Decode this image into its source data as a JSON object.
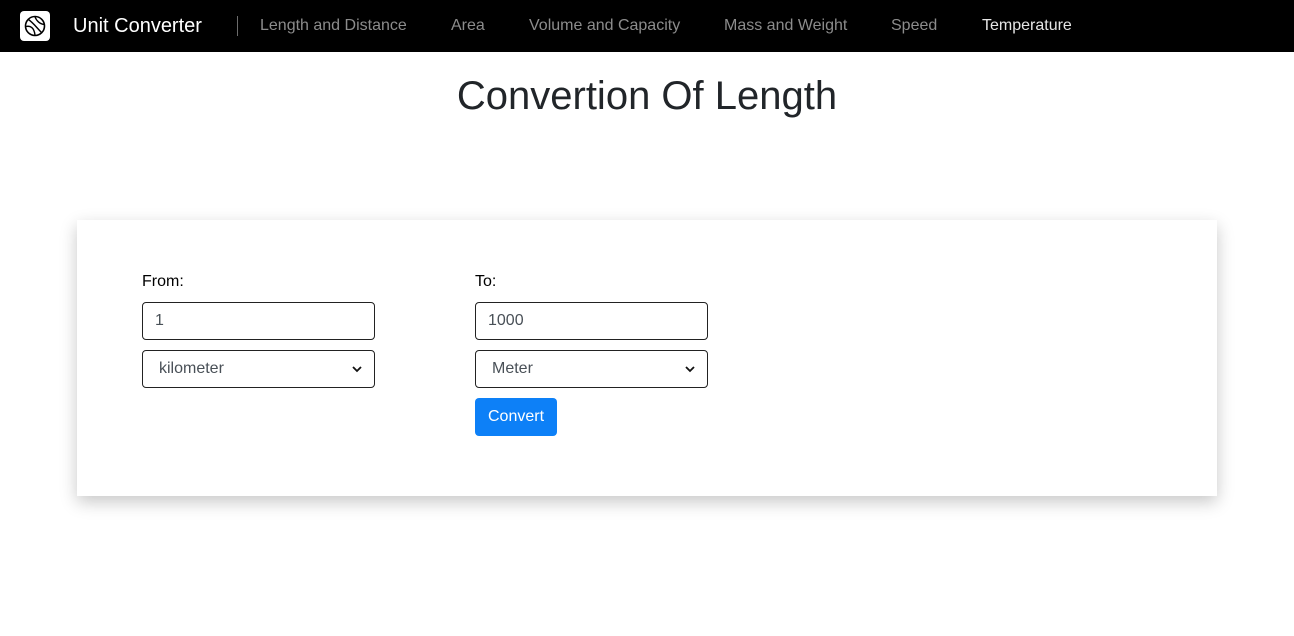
{
  "navbar": {
    "brand": "Unit Converter",
    "links": [
      {
        "label": "Length and Distance"
      },
      {
        "label": "Area"
      },
      {
        "label": "Volume and Capacity"
      },
      {
        "label": "Mass and Weight"
      },
      {
        "label": "Speed"
      },
      {
        "label": "Temperature"
      }
    ]
  },
  "page": {
    "title": "Convertion Of Length"
  },
  "form": {
    "from_label": "From:",
    "from_value": "1",
    "from_unit": "kilometer",
    "to_label": "To:",
    "to_value": "1000",
    "to_unit": "Meter",
    "convert_label": "Convert"
  },
  "colors": {
    "navbar_bg": "#000000",
    "primary_button": "#0d80f7"
  }
}
